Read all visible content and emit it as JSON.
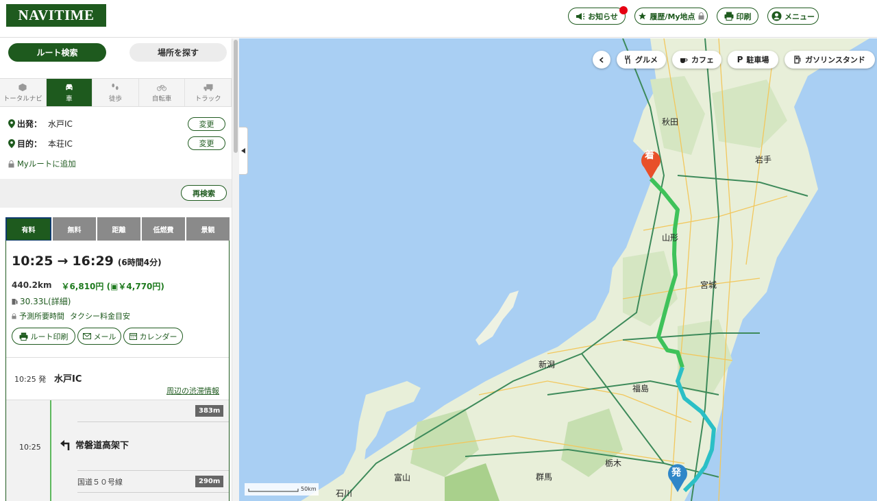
{
  "header": {
    "logo": "NAVITIME",
    "buttons": {
      "notice": "お知らせ",
      "history": "履歴/My地点",
      "print": "印刷",
      "menu": "メニュー"
    }
  },
  "sidebar": {
    "top_tabs": {
      "route_search": "ルート検索",
      "place_search": "場所を探す"
    },
    "modes": [
      "トータルナビ",
      "車",
      "徒歩",
      "自転車",
      "トラック"
    ],
    "active_mode": "車",
    "departure": {
      "label": "出発：",
      "value": "水戸IC",
      "change": "変更"
    },
    "destination": {
      "label": "目的：",
      "value": "本荘IC",
      "change": "変更"
    },
    "my_route": "Myルートに追加",
    "research": "再検索",
    "route_tabs": [
      "有料",
      "無料",
      "距離",
      "低燃費",
      "景観"
    ],
    "active_route_tab": "有料",
    "summary": {
      "depart_time": "10:25",
      "arrow": "→",
      "arrive_time": "16:29",
      "duration": "(6時間4分)",
      "distance": "440.2km",
      "toll": "￥6,810円",
      "etc_toll": "(▣￥4,770円)",
      "fuel": "30.33L(詳細)",
      "predict": "予測所要時間",
      "taxi": "タクシー料金目安"
    },
    "actions": {
      "print": "ルート印刷",
      "mail": "メール",
      "calendar": "カレンダー"
    },
    "start_point": {
      "time": "10:25 発",
      "name": "水戸IC",
      "traffic": "周辺の渋滞情報"
    },
    "step": {
      "dist_before": "383m",
      "time": "10:25",
      "name": "常磐道高架下",
      "road": "国道５０号線",
      "dist_after": "290m"
    }
  },
  "map": {
    "poi_buttons": [
      "グルメ",
      "カフェ",
      "駐車場",
      "ガソリンスタンド"
    ],
    "cities": [
      "秋田",
      "岩手",
      "山形",
      "宮城",
      "新潟",
      "福島",
      "栃木",
      "群馬",
      "富山",
      "石川"
    ],
    "markers": {
      "arrival": "着",
      "departure": "発"
    },
    "scale": "50km",
    "colors": {
      "land": "#e8efd9",
      "sea": "#a9cff3",
      "route_green": "#3fc25a",
      "route_teal": "#2bbfc6"
    }
  },
  "colors": {
    "brand": "#1e5a1e",
    "notice_dot": "#e60012",
    "tab_gray": "#8a8a8a"
  }
}
